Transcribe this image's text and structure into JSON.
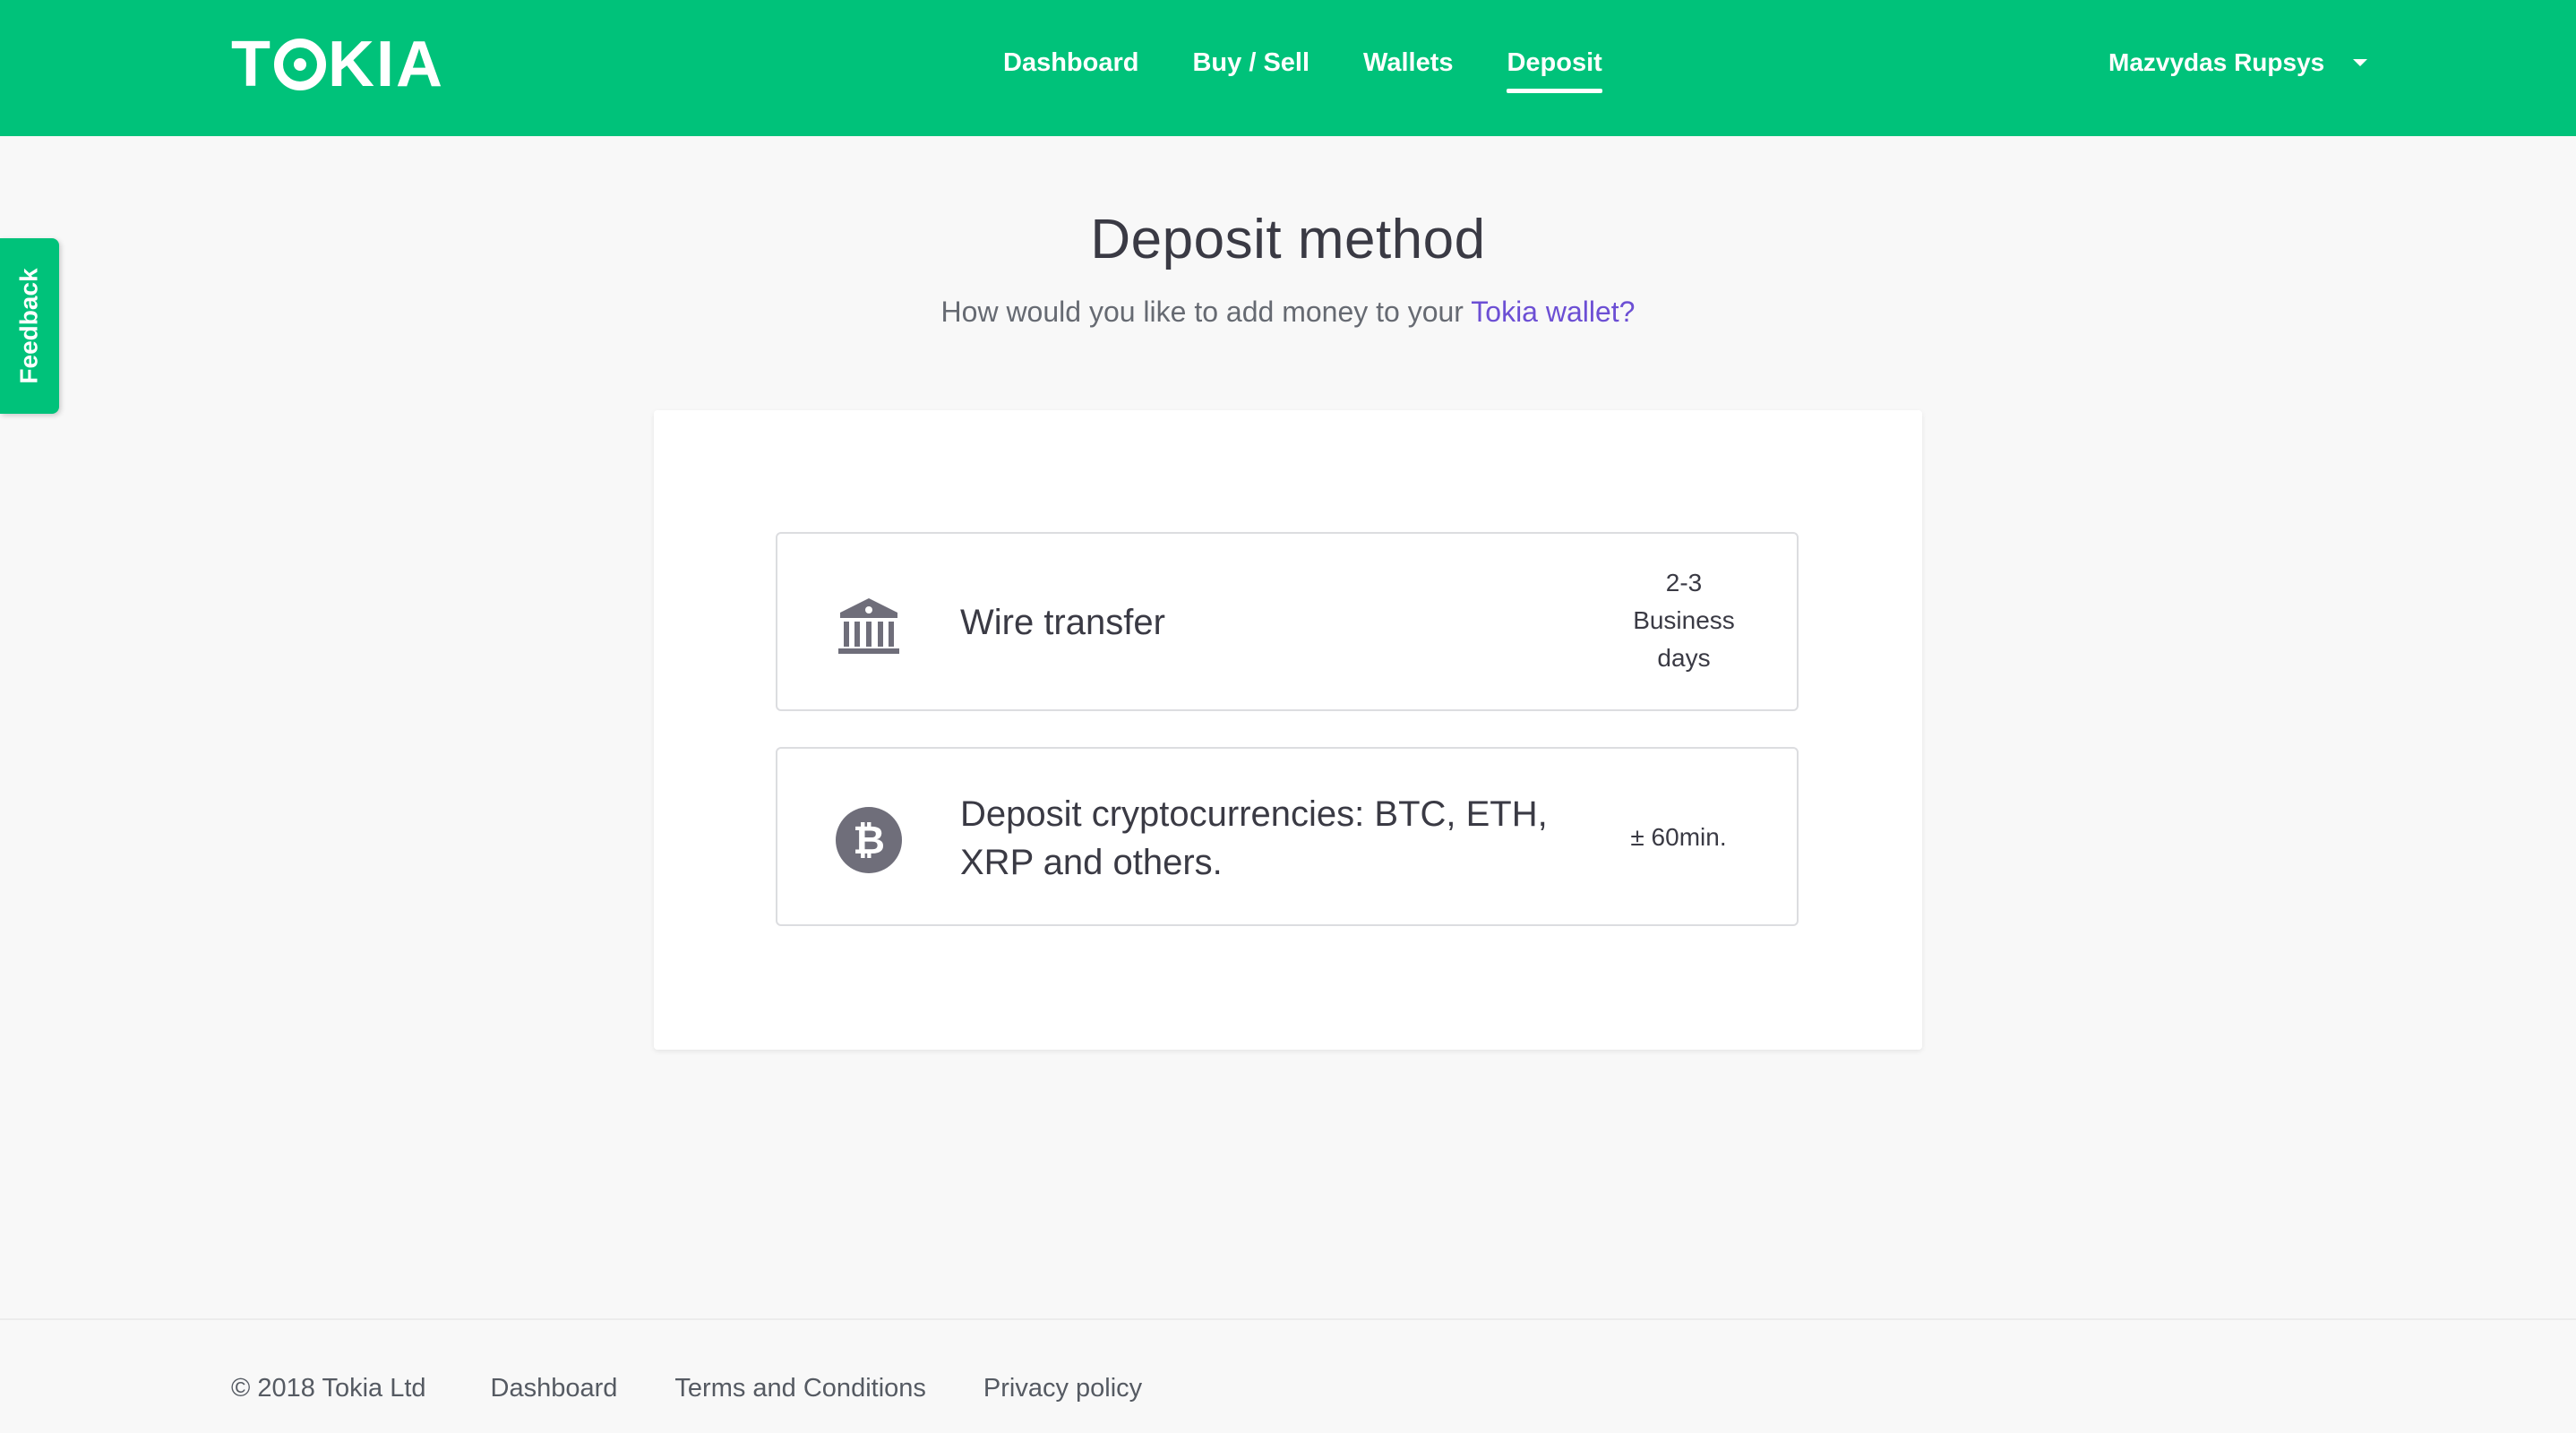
{
  "header": {
    "logo": "TOKIA",
    "nav": [
      {
        "label": "Dashboard",
        "active": false
      },
      {
        "label": "Buy / Sell",
        "active": false
      },
      {
        "label": "Wallets",
        "active": false
      },
      {
        "label": "Deposit",
        "active": true
      }
    ],
    "user_name": "Mazvydas Rupsys"
  },
  "feedback": {
    "label": "Feedback"
  },
  "main": {
    "title": "Deposit method",
    "subtitle_prefix": "How would you like to add money to your ",
    "subtitle_link": "Tokia wallet?",
    "options": [
      {
        "icon": "bank-icon",
        "title": "Wire transfer",
        "time_lines": [
          "2-3",
          "Business",
          "days"
        ]
      },
      {
        "icon": "bitcoin-icon",
        "title": "Deposit cryptocurrencies: BTC, ETH, XRP and others.",
        "time_lines": [
          "± 60min."
        ]
      }
    ]
  },
  "footer": {
    "copyright": "© 2018 Tokia Ltd",
    "links": [
      "Dashboard",
      "Terms and Conditions",
      "Privacy policy"
    ]
  },
  "colors": {
    "brand_green": "#00c27a",
    "link_purple": "#6c4fd4",
    "icon_gray": "#6f6e7a"
  }
}
